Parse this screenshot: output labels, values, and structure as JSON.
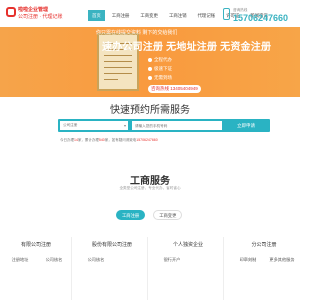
{
  "brand": {
    "line1": "啦啦企业管理",
    "line2": "公司注册 · 代理记账"
  },
  "nav": {
    "items": [
      "首页",
      "工商注册",
      "工商变更",
      "工商注销",
      "代理记账",
      "许可证",
      "新闻资讯"
    ]
  },
  "hotline": {
    "label": "咨询热线",
    "number": "15706247660"
  },
  "banner": {
    "sub": "你只需在线提交资料 剩下的交给我们",
    "headline": "速办公司注册 无地址注册 无资金注册",
    "features": [
      "全程代办",
      "极速下证",
      "无需到场"
    ],
    "phone": "咨询热线 13405404949"
  },
  "booking": {
    "title": "快速预约所需服务",
    "select_value": "公司注册",
    "input_placeholder": "请输入您的手机号码",
    "button_label": "立即申请",
    "stats_prefix": "今日办理",
    "stats_today": "14",
    "stats_mid": "家，累计办理",
    "stats_total": "540",
    "stats_suffix": "家，如有疑问请致电",
    "stats_phone": "15706247660"
  },
  "services": {
    "title": "工商服务",
    "subtitle": "全类型公司注册，专业代办，省时省心",
    "tabs": [
      "工商注册",
      "工商变更"
    ],
    "columns": [
      {
        "title": "有限公司注册",
        "items": [
          "注册地址",
          "公司核名",
          "",
          ""
        ]
      },
      {
        "title": "股份有限公司注册",
        "items": [
          "公司核名",
          "",
          "",
          ""
        ]
      },
      {
        "title": "个人独资企业",
        "items": [
          "银行开户",
          "",
          "",
          ""
        ]
      },
      {
        "title": "分公司注册",
        "items": [
          "印章刻制",
          "更多其他服务",
          "",
          ""
        ]
      }
    ]
  },
  "colors": {
    "accent": "#2ab3c3",
    "banner": "#f99a3e",
    "brand_red": "#e6312d"
  }
}
